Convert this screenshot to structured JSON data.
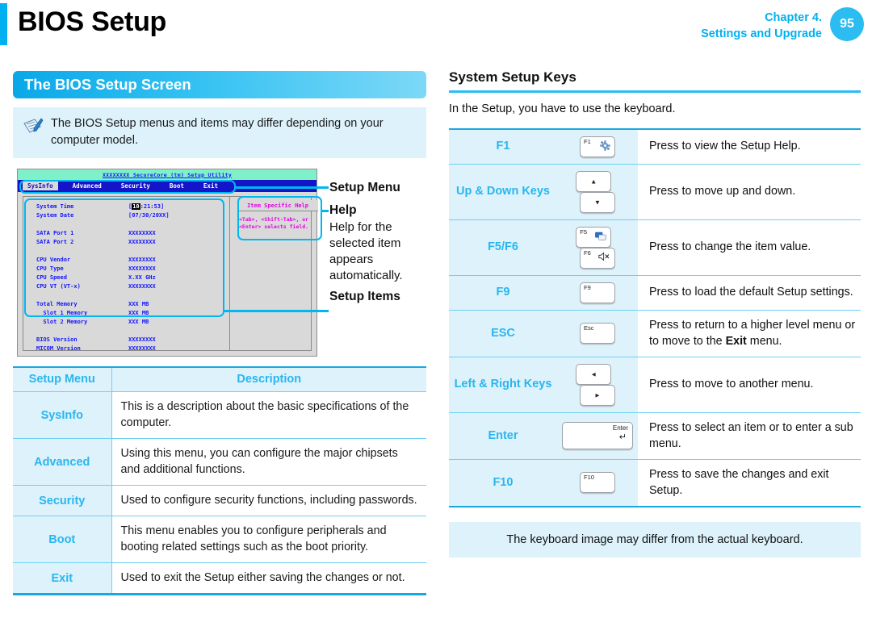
{
  "header": {
    "title": "BIOS Setup",
    "chapter_line1": "Chapter 4.",
    "chapter_line2": "Settings and Upgrade",
    "page_number": "95"
  },
  "left": {
    "section_banner": "The BIOS Setup Screen",
    "note": "The BIOS Setup menus and items may differ depending on your computer model.",
    "note_icon": "note-pencil-icon"
  },
  "bios_screen": {
    "title_bar": "XXXXXXXX SecureCore (tm) Setup Utility",
    "menu_items": [
      "SysInfo",
      "Advanced",
      "Security",
      "Boot",
      "Exit"
    ],
    "selected_menu": "SysInfo",
    "items": [
      {
        "label": "System Time",
        "value": "[10:21:53]",
        "highlight": "10"
      },
      {
        "label": "System Date",
        "value": "[07/30/20XX]"
      },
      {
        "label": "SATA Port 1",
        "value": "XXXXXXXX"
      },
      {
        "label": "SATA Port 2",
        "value": "XXXXXXXX"
      },
      {
        "label": "CPU Vendor",
        "value": "XXXXXXXX"
      },
      {
        "label": "CPU Type",
        "value": "XXXXXXXX"
      },
      {
        "label": "CPU Speed",
        "value": "X.XX GHz"
      },
      {
        "label": "CPU VT (VT-x)",
        "value": "XXXXXXXX"
      },
      {
        "label": "Total Memory",
        "value": "XXX MB"
      },
      {
        "label": "  Slot 1 Memory",
        "value": "XXX MB"
      },
      {
        "label": "  Slot 2 Memory",
        "value": "XXX MB"
      },
      {
        "label": "BIOS Version",
        "value": "XXXXXXXX"
      },
      {
        "label": "MICOM Version",
        "value": "XXXXXXXX"
      }
    ],
    "help_panel_title": "Item Specific Help",
    "help_panel_text": "<Tab>, <Shift-Tab>, or <Enter> selects field."
  },
  "callouts": {
    "setup_menu": "Setup Menu",
    "help": "Help",
    "help_desc": "Help for the selected item appears automatically.",
    "setup_items": "Setup Items"
  },
  "menu_table": {
    "headers": [
      "Setup Menu",
      "Description"
    ],
    "rows": [
      {
        "menu": "SysInfo",
        "description": "This is a description about the basic specifications of the computer."
      },
      {
        "menu": "Advanced",
        "description": "Using this menu, you can configure the major chipsets and additional functions."
      },
      {
        "menu": "Security",
        "description": "Used to configure security functions, including passwords."
      },
      {
        "menu": "Boot",
        "description": "This menu enables you to configure peripherals and booting related settings such as the boot priority."
      },
      {
        "menu": "Exit",
        "description": "Used to exit the Setup either saving the changes or not."
      }
    ]
  },
  "right": {
    "title": "System Setup Keys",
    "intro": "In the Setup, you have to use the keyboard.",
    "rows": [
      {
        "name": "F1",
        "keycaps": [
          {
            "label": "F1",
            "icon": "gear-icon"
          }
        ],
        "description": "Press to view the Setup Help."
      },
      {
        "name": "Up & Down Keys",
        "keycaps": [
          {
            "arrow": "▲"
          },
          {
            "arrow": "▼"
          }
        ],
        "description": "Press to move up and down."
      },
      {
        "name": "F5/F6",
        "keycaps": [
          {
            "label": "F5",
            "icon": "display-switch-icon"
          },
          {
            "label": "F6",
            "icon": "mute-speaker-icon"
          }
        ],
        "description": "Press to change the item value."
      },
      {
        "name": "F9",
        "keycaps": [
          {
            "label": "F9"
          }
        ],
        "description": "Press to load the default Setup settings."
      },
      {
        "name": "ESC",
        "keycaps": [
          {
            "label": "Esc"
          }
        ],
        "description_prefix": "Press to return to a higher level menu or to move to the ",
        "description_bold": "Exit",
        "description_suffix": " menu."
      },
      {
        "name": "Left & Right Keys",
        "keycaps": [
          {
            "arrow": "◄"
          },
          {
            "arrow": "►"
          }
        ],
        "description": "Press to move to another menu."
      },
      {
        "name": "Enter",
        "keycaps": [
          {
            "label": "Enter",
            "wide": true,
            "icon": "enter-return-icon"
          }
        ],
        "description": "Press to select an item or to enter a sub menu."
      },
      {
        "name": "F10",
        "keycaps": [
          {
            "label": "F10"
          }
        ],
        "description": "Press to save the changes and exit Setup."
      }
    ],
    "footer_note": "The keyboard image may differ from the actual keyboard."
  },
  "colors": {
    "accent": "#00b0f0",
    "accent_light": "#ddf2fb",
    "table_label": "#29b6ef",
    "bios_blue": "#1414ff",
    "bios_magenta": "#e600e6"
  }
}
